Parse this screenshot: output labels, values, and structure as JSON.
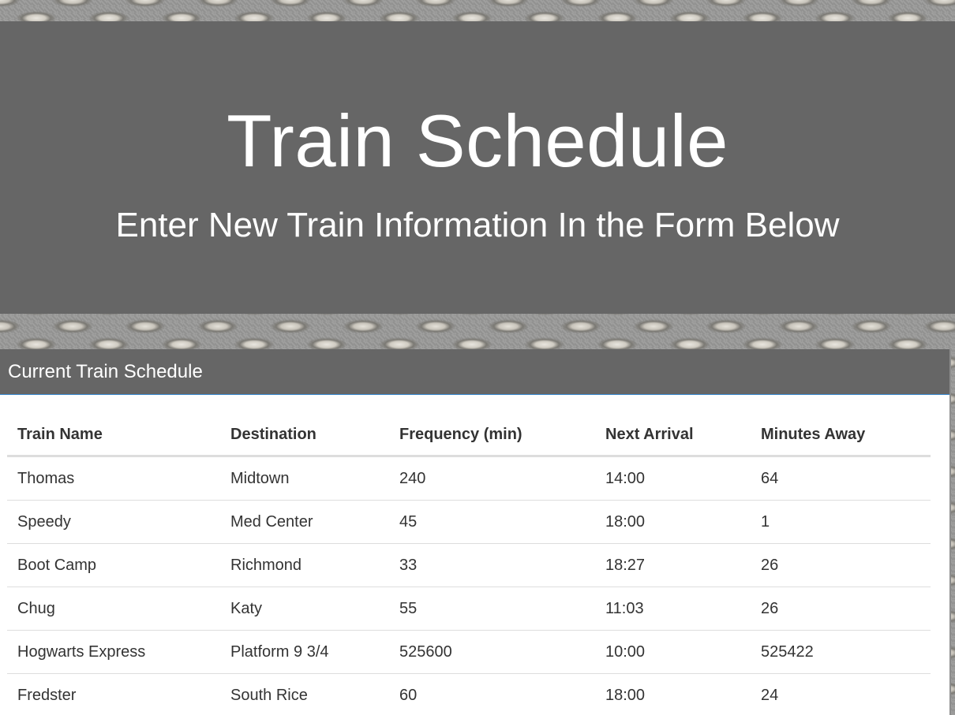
{
  "header": {
    "title": "Train Schedule",
    "subtitle": "Enter New Train Information In the Form Below"
  },
  "schedule": {
    "panel_title": "Current Train Schedule",
    "columns": [
      "Train Name",
      "Destination",
      "Frequency (min)",
      "Next Arrival",
      "Minutes Away"
    ],
    "rows": [
      [
        "Thomas",
        "Midtown",
        "240",
        "14:00",
        "64"
      ],
      [
        "Speedy",
        "Med Center",
        "45",
        "18:00",
        "1"
      ],
      [
        "Boot Camp",
        "Richmond",
        "33",
        "18:27",
        "26"
      ],
      [
        "Chug",
        "Katy",
        "55",
        "11:03",
        "26"
      ],
      [
        "Hogwarts Express",
        "Platform 9 3/4",
        "525600",
        "10:00",
        "525422"
      ],
      [
        "Fredster",
        "South Rice",
        "60",
        "18:00",
        "24"
      ]
    ]
  },
  "colors": {
    "header_background": "#666666",
    "panel_border_accent": "#3f8fd6",
    "background_texture": "diamond-plate-steel"
  }
}
